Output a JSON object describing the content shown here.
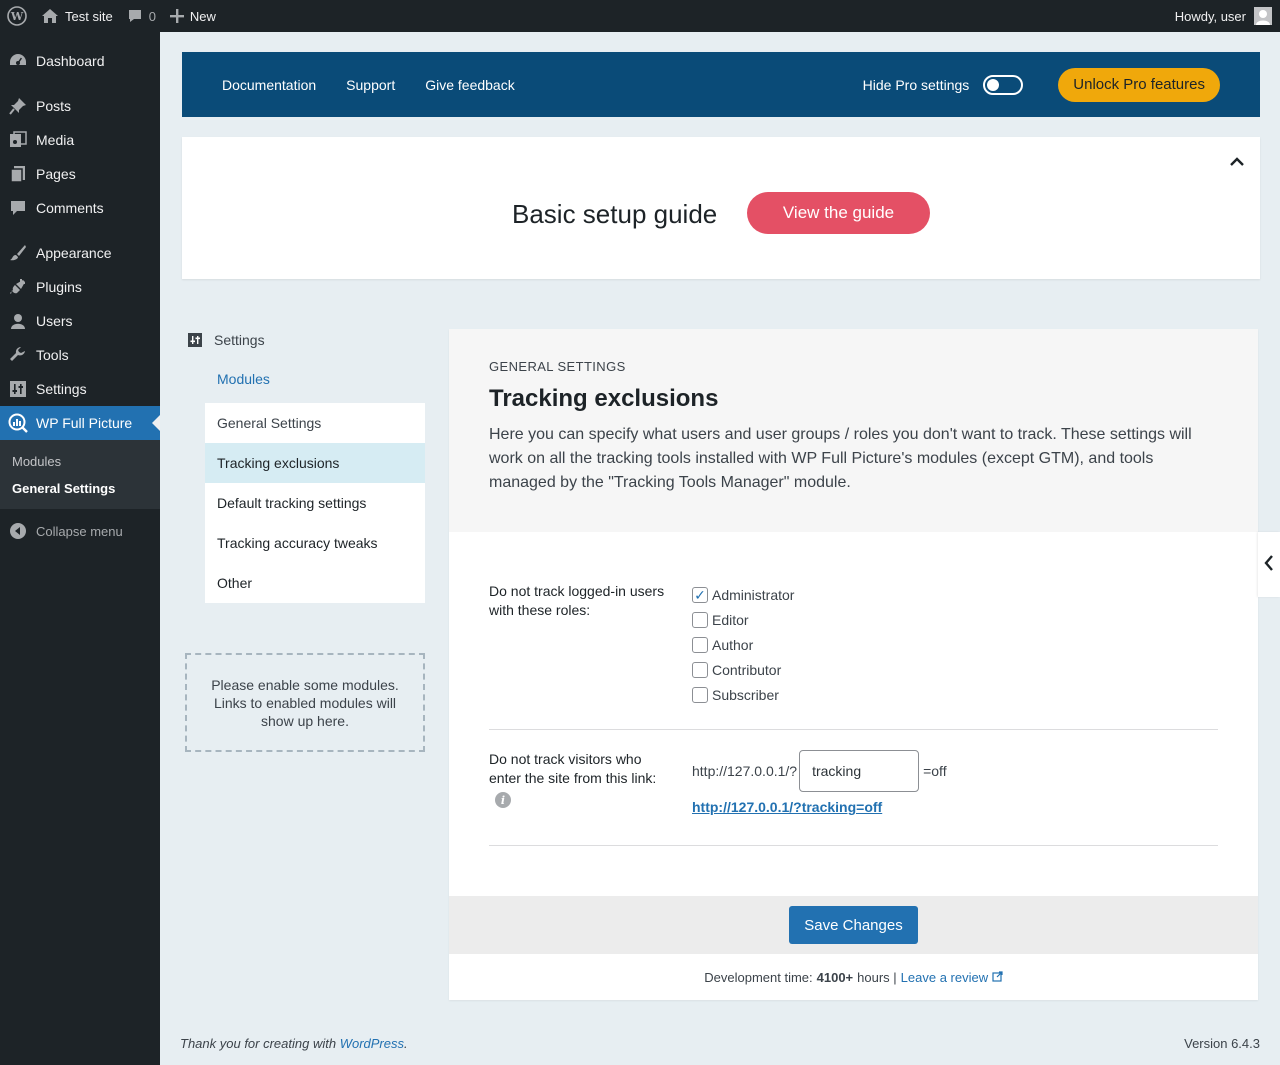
{
  "admin_bar": {
    "site_name": "Test site",
    "comments_count": "0",
    "new_label": "New",
    "howdy": "Howdy, user"
  },
  "sidebar": {
    "items": [
      {
        "label": "Dashboard",
        "icon": "dashboard-icon"
      },
      {
        "label": "Posts",
        "icon": "pin-icon"
      },
      {
        "label": "Media",
        "icon": "media-icon"
      },
      {
        "label": "Pages",
        "icon": "pages-icon"
      },
      {
        "label": "Comments",
        "icon": "comment-icon"
      },
      {
        "label": "Appearance",
        "icon": "brush-icon"
      },
      {
        "label": "Plugins",
        "icon": "plug-icon"
      },
      {
        "label": "Users",
        "icon": "user-icon"
      },
      {
        "label": "Tools",
        "icon": "wrench-icon"
      },
      {
        "label": "Settings",
        "icon": "sliders-icon"
      },
      {
        "label": "WP Full Picture",
        "icon": "analytics-icon"
      }
    ],
    "submenu": [
      "Modules",
      "General Settings"
    ],
    "collapse": "Collapse menu"
  },
  "topbar": {
    "links": [
      "Documentation",
      "Support",
      "Give feedback"
    ],
    "hide_pro_label": "Hide Pro settings",
    "hide_pro_on": false,
    "unlock_label": "Unlock Pro features",
    "color": "#0a4b78",
    "accent": "#f0a80b"
  },
  "guide": {
    "title": "Basic setup guide",
    "button": "View the guide",
    "button_color": "#e45065"
  },
  "left_nav": {
    "heading": "Settings",
    "modules_link": "Modules",
    "items": [
      "General Settings",
      "Tracking exclusions",
      "Default tracking settings",
      "Tracking accuracy tweaks",
      "Other"
    ],
    "active_index": 1,
    "notice": "Please enable some modules. Links to enabled modules will show up here."
  },
  "panel": {
    "section": "GENERAL SETTINGS",
    "title": "Tracking exclusions",
    "description": "Here you can specify what users and user groups / roles you don't want to track. These settings will work on all the tracking tools installed with WP Full Picture's modules (except GTM), and tools managed by the \"Tracking Tools Manager\" module.",
    "roles_label": "Do not track logged-in users with these roles:",
    "roles": [
      {
        "name": "Administrator",
        "checked": true
      },
      {
        "name": "Editor",
        "checked": false
      },
      {
        "name": "Author",
        "checked": false
      },
      {
        "name": "Contributor",
        "checked": false
      },
      {
        "name": "Subscriber",
        "checked": false
      }
    ],
    "link_label": "Do not track visitors who enter the site from this link:",
    "url_prefix": "http://127.0.0.1/?",
    "url_param": "tracking",
    "url_suffix": "=off",
    "url_full": "http://127.0.0.1/?tracking=off",
    "save_label": "Save Changes",
    "credit_prefix": "Development time:",
    "credit_hours": "4100+",
    "credit_middle": "hours |",
    "review_link": "Leave a review"
  },
  "footer": {
    "thanks_prefix": "Thank you for creating with",
    "thanks_link": "WordPress",
    "thanks_suffix": ".",
    "version": "Version 6.4.3"
  }
}
